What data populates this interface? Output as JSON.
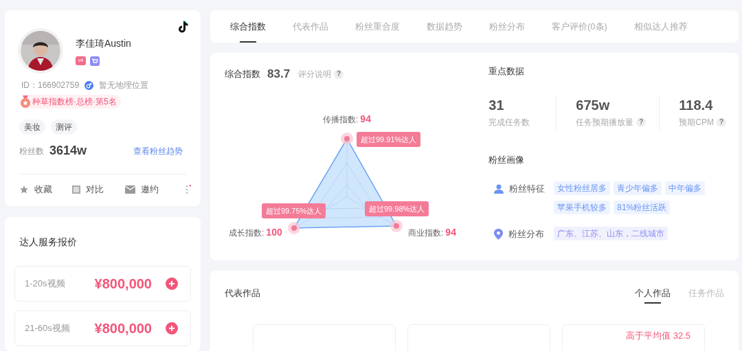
{
  "profile": {
    "name": "李佳琦Austin",
    "level_badge": "v4",
    "id": "ID：166902759",
    "location": "暂无地理位置",
    "rank": "种草指数榜·总榜·第5名",
    "tags": [
      "美妆",
      "测评"
    ],
    "fans_label": "粉丝数",
    "fans_value": "3614w",
    "fans_link": "查看粉丝趋势",
    "actions": [
      {
        "kind": "star",
        "label": "收藏"
      },
      {
        "kind": "compare",
        "label": "对比"
      },
      {
        "kind": "mail",
        "label": "邀约"
      }
    ]
  },
  "pricing": {
    "title": "达人服务报价",
    "items": [
      {
        "label": "1-20s视频",
        "price": "¥800,000"
      },
      {
        "label": "21-60s视频",
        "price": "¥800,000"
      }
    ]
  },
  "tabs": [
    {
      "label": "综合指数",
      "selected": true
    },
    {
      "label": "代表作品",
      "selected": false
    },
    {
      "label": "粉丝重合度",
      "selected": false
    },
    {
      "label": "数据趋势",
      "selected": false
    },
    {
      "label": "粉丝分布",
      "selected": false
    },
    {
      "label": "客户评价(0条)",
      "selected": false
    },
    {
      "label": "相似达人推荐",
      "selected": false
    }
  ],
  "index": {
    "title": "综合指数",
    "score": "83.7",
    "help": "评分说明",
    "help_icon": "?",
    "radar": [
      {
        "label": "传播指数:",
        "value": "94",
        "badge": "超过99.91%达人"
      },
      {
        "label": "成长指数:",
        "value": "100",
        "badge": "超过99.75%达人"
      },
      {
        "label": "商业指数:",
        "value": "94",
        "badge": "超过99.98%达人"
      }
    ]
  },
  "key_data": {
    "title": "重点数据",
    "stats": [
      {
        "value": "31",
        "label": "完成任务数"
      },
      {
        "value": "675w",
        "label": "任务预期播放量",
        "help_icon": "?"
      },
      {
        "value": "118.4",
        "label": "预期CPM",
        "help_icon": "?"
      }
    ]
  },
  "fan_portrait": {
    "title": "粉丝画像",
    "rows": [
      {
        "kind": "person",
        "label": "粉丝特征",
        "tags": [
          "女性粉丝居多",
          "青少年偏多",
          "中年偏多",
          "苹果手机较多",
          "81%粉丝活跃"
        ]
      },
      {
        "kind": "location",
        "label": "粉丝分布",
        "tags": [
          "广东、江苏、山东，二线城市"
        ]
      }
    ]
  },
  "works": {
    "title": "代表作品",
    "tabs": [
      {
        "label": "个人作品",
        "selected": true
      },
      {
        "label": "任务作品",
        "selected": false
      }
    ],
    "cards": [
      {
        "kind": "empty"
      },
      {
        "kind": "empty"
      },
      {
        "kind": "note",
        "note": "高于平均值 32.5"
      }
    ]
  }
}
